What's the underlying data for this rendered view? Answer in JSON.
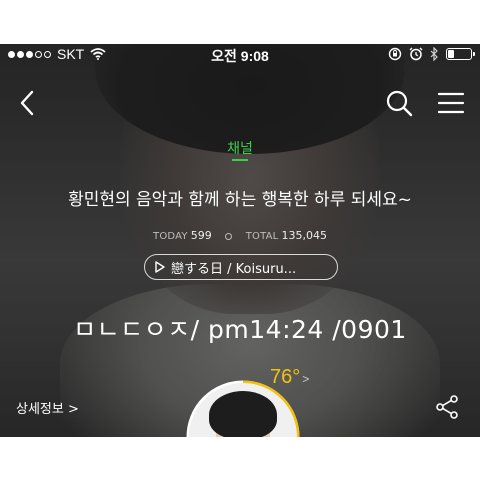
{
  "status_bar": {
    "carrier": "SKT",
    "time": "오전 9:08"
  },
  "channel": {
    "label": "채널"
  },
  "headline": "황민현의 음악과 함께 하는 행복한 하루 되세요~",
  "stats": {
    "today_label": "TODAY",
    "today_value": "599",
    "total_label": "TOTAL",
    "total_value": "135,045"
  },
  "song": {
    "title": "戀する日 / Koisuru..."
  },
  "overlay_text": "ㅁㄴㄷㅇㅈ/ pm14:24 /0901",
  "detail_link": "상세정보 >",
  "temperature": {
    "value": "76°",
    "chevron": ">"
  },
  "colors": {
    "accent_green": "#3ecf4a",
    "temperature_yellow": "#f4c20d"
  },
  "icons": [
    "back-icon",
    "search-icon",
    "menu-icon",
    "play-icon",
    "share-icon",
    "wifi-icon",
    "rotation-lock-icon",
    "alarm-icon",
    "bluetooth-icon",
    "battery-icon"
  ]
}
